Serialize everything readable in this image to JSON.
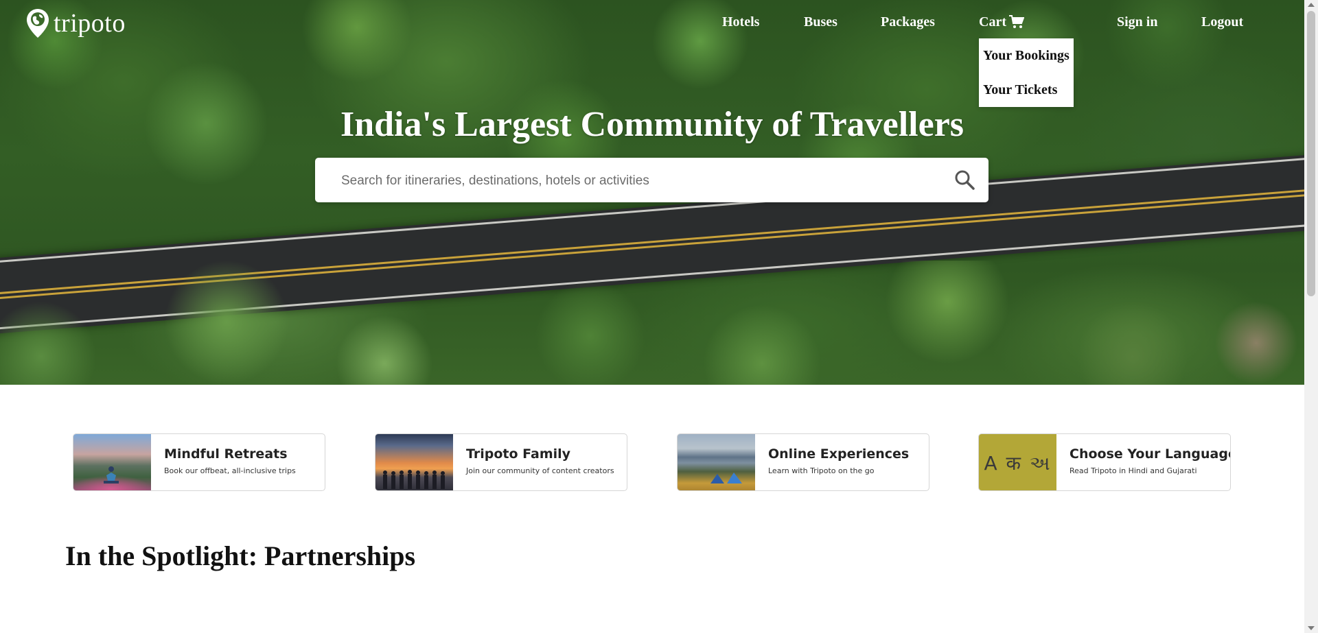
{
  "brand": {
    "name": "tripoto"
  },
  "nav": {
    "hotels": "Hotels",
    "buses": "Buses",
    "packages": "Packages",
    "cart": "Cart",
    "sign_in": "Sign in",
    "logout": "Logout"
  },
  "cart_dropdown": {
    "items": [
      "Your Bookings",
      "Your Tickets"
    ]
  },
  "hero": {
    "title": "India's Largest Community of Travellers",
    "search_placeholder": "Search for itineraries, destinations, hotels or activities"
  },
  "cards": [
    {
      "title": "Mindful Retreats",
      "subtitle": "Book our offbeat, all-inclusive trips"
    },
    {
      "title": "Tripoto Family",
      "subtitle": "Join our community of content creators"
    },
    {
      "title": "Online Experiences",
      "subtitle": "Learn with Tripoto on the go"
    },
    {
      "title": "Choose Your Language",
      "subtitle": "Read Tripoto in Hindi and Gujarati",
      "image_text": "A क અ"
    }
  ],
  "spotlight": {
    "heading": "In the Spotlight: Partnerships"
  },
  "colors": {
    "language_card_bg": "#b3a737",
    "text_dark": "#222222"
  },
  "icons": [
    "location-pin-icon",
    "cart-icon",
    "search-icon"
  ]
}
